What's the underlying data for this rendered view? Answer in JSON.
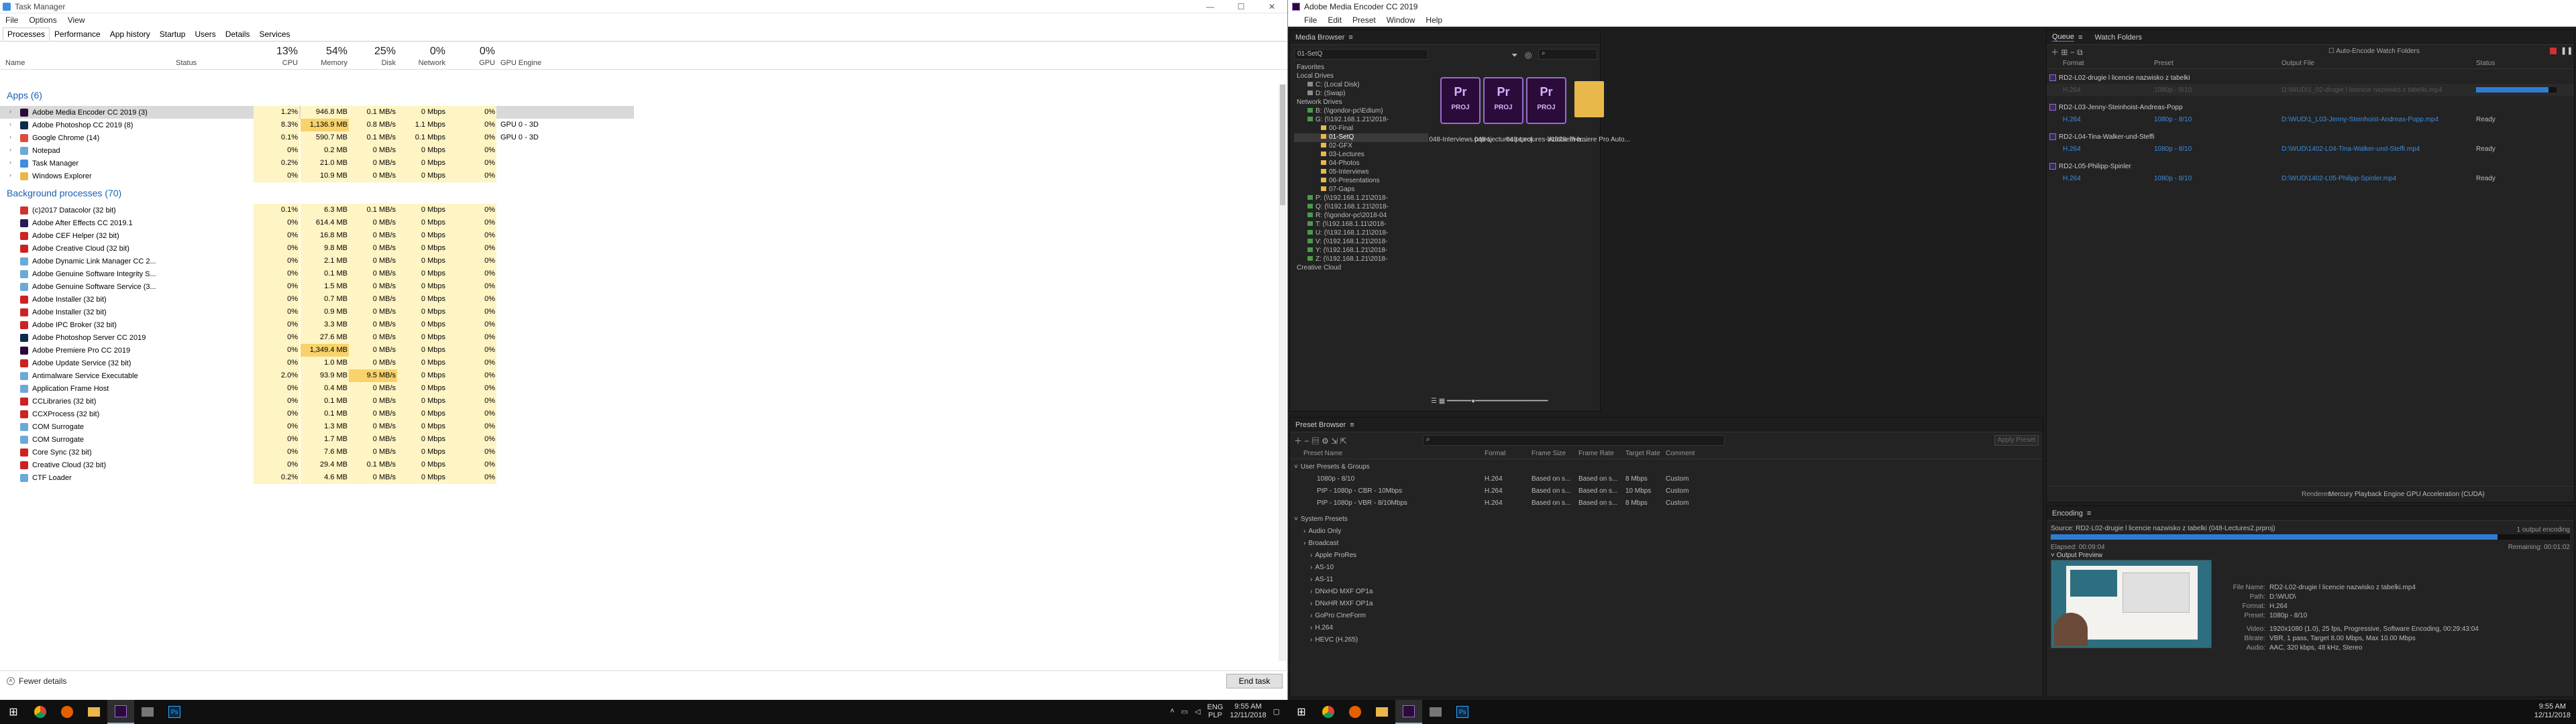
{
  "taskmanager": {
    "title": "Task Manager",
    "window_buttons": [
      "—",
      "☐",
      "✕"
    ],
    "menu": [
      "File",
      "Options",
      "View"
    ],
    "tabs": [
      "Processes",
      "Performance",
      "App history",
      "Startup",
      "Users",
      "Details",
      "Services"
    ],
    "header": {
      "name": "Name",
      "status": "Status",
      "cpu_pct": "13%",
      "cpu": "CPU",
      "mem_pct": "54%",
      "mem": "Memory",
      "disk_pct": "25%",
      "disk": "Disk",
      "net_pct": "0%",
      "net": "Network",
      "gpu_pct": "0%",
      "gpu": "GPU",
      "gpu_engine": "GPU Engine"
    },
    "apps_section": "Apps (6)",
    "apps": [
      {
        "name": "Adobe Media Encoder CC 2019 (3)",
        "cpu": "1.2%",
        "mem": "946.8 MB",
        "disk": "0.1 MB/s",
        "net": "0 Mbps",
        "gpu": "0%",
        "engine": "",
        "icon_color": "#2b0b3a"
      },
      {
        "name": "Adobe Photoshop CC 2019 (8)",
        "cpu": "8.3%",
        "mem": "1,136.9 MB",
        "disk": "0.8 MB/s",
        "net": "1.1 Mbps",
        "gpu": "0%",
        "engine": "GPU 0 - 3D",
        "icon_color": "#0a2c4a"
      },
      {
        "name": "Google Chrome (14)",
        "cpu": "0.1%",
        "mem": "590.7 MB",
        "disk": "0.1 MB/s",
        "net": "0.1 Mbps",
        "gpu": "0%",
        "engine": "GPU 0 - 3D",
        "icon_color": "#dd4b39"
      },
      {
        "name": "Notepad",
        "cpu": "0%",
        "mem": "0.2 MB",
        "disk": "0 MB/s",
        "net": "0 Mbps",
        "gpu": "0%",
        "engine": "",
        "icon_color": "#6aa9d8"
      },
      {
        "name": "Task Manager",
        "cpu": "0.2%",
        "mem": "21.0 MB",
        "disk": "0 MB/s",
        "net": "0 Mbps",
        "gpu": "0%",
        "engine": "",
        "icon_color": "#3b8ee0"
      },
      {
        "name": "Windows Explorer",
        "cpu": "0%",
        "mem": "10.9 MB",
        "disk": "0 MB/s",
        "net": "0 Mbps",
        "gpu": "0%",
        "engine": "",
        "icon_color": "#e8b84a"
      }
    ],
    "bg_section": "Background processes (70)",
    "background": [
      {
        "name": "(c)2017 Datacolor (32 bit)",
        "cpu": "0.1%",
        "mem": "6.3 MB",
        "disk": "0.1 MB/s",
        "net": "0 Mbps",
        "gpu": "0%",
        "icon_color": "#cc3333"
      },
      {
        "name": "Adobe After Effects CC 2019.1",
        "cpu": "0%",
        "mem": "614.4 MB",
        "disk": "0 MB/s",
        "net": "0 Mbps",
        "gpu": "0%",
        "icon_color": "#2a1a55"
      },
      {
        "name": "Adobe CEF Helper (32 bit)",
        "cpu": "0%",
        "mem": "16.8 MB",
        "disk": "0 MB/s",
        "net": "0 Mbps",
        "gpu": "0%",
        "icon_color": "#cc2222"
      },
      {
        "name": "Adobe Creative Cloud (32 bit)",
        "cpu": "0%",
        "mem": "9.8 MB",
        "disk": "0 MB/s",
        "net": "0 Mbps",
        "gpu": "0%",
        "icon_color": "#cc2222"
      },
      {
        "name": "Adobe Dynamic Link Manager CC 2...",
        "cpu": "0%",
        "mem": "2.1 MB",
        "disk": "0 MB/s",
        "net": "0 Mbps",
        "gpu": "0%",
        "icon_color": "#6aa9d8"
      },
      {
        "name": "Adobe Genuine Software Integrity S...",
        "cpu": "0%",
        "mem": "0.1 MB",
        "disk": "0 MB/s",
        "net": "0 Mbps",
        "gpu": "0%",
        "icon_color": "#6aa9d8"
      },
      {
        "name": "Adobe Genuine Software Service (3...",
        "cpu": "0%",
        "mem": "1.5 MB",
        "disk": "0 MB/s",
        "net": "0 Mbps",
        "gpu": "0%",
        "icon_color": "#6aa9d8"
      },
      {
        "name": "Adobe Installer (32 bit)",
        "cpu": "0%",
        "mem": "0.7 MB",
        "disk": "0 MB/s",
        "net": "0 Mbps",
        "gpu": "0%",
        "icon_color": "#cc2222"
      },
      {
        "name": "Adobe Installer (32 bit)",
        "cpu": "0%",
        "mem": "0.9 MB",
        "disk": "0 MB/s",
        "net": "0 Mbps",
        "gpu": "0%",
        "icon_color": "#cc2222"
      },
      {
        "name": "Adobe IPC Broker (32 bit)",
        "cpu": "0%",
        "mem": "3.3 MB",
        "disk": "0 MB/s",
        "net": "0 Mbps",
        "gpu": "0%",
        "icon_color": "#cc2222"
      },
      {
        "name": "Adobe Photoshop Server CC 2019",
        "cpu": "0%",
        "mem": "27.6 MB",
        "disk": "0 MB/s",
        "net": "0 Mbps",
        "gpu": "0%",
        "icon_color": "#0a2c4a"
      },
      {
        "name": "Adobe Premiere Pro CC 2019",
        "cpu": "0%",
        "mem": "1,349.4 MB",
        "disk": "0 MB/s",
        "net": "0 Mbps",
        "gpu": "0%",
        "icon_color": "#2b0b3a"
      },
      {
        "name": "Adobe Update Service (32 bit)",
        "cpu": "0%",
        "mem": "1.0 MB",
        "disk": "0 MB/s",
        "net": "0 Mbps",
        "gpu": "0%",
        "icon_color": "#cc2222"
      },
      {
        "name": "Antimalware Service Executable",
        "cpu": "2.0%",
        "mem": "93.9 MB",
        "disk": "9.5 MB/s",
        "net": "0 Mbps",
        "gpu": "0%",
        "icon_color": "#6aa9d8"
      },
      {
        "name": "Application Frame Host",
        "cpu": "0%",
        "mem": "0.4 MB",
        "disk": "0 MB/s",
        "net": "0 Mbps",
        "gpu": "0%",
        "icon_color": "#6aa9d8"
      },
      {
        "name": "CCLibraries (32 bit)",
        "cpu": "0%",
        "mem": "0.1 MB",
        "disk": "0 MB/s",
        "net": "0 Mbps",
        "gpu": "0%",
        "icon_color": "#cc2222"
      },
      {
        "name": "CCXProcess (32 bit)",
        "cpu": "0%",
        "mem": "0.1 MB",
        "disk": "0 MB/s",
        "net": "0 Mbps",
        "gpu": "0%",
        "icon_color": "#cc2222"
      },
      {
        "name": "COM Surrogate",
        "cpu": "0%",
        "mem": "1.3 MB",
        "disk": "0 MB/s",
        "net": "0 Mbps",
        "gpu": "0%",
        "icon_color": "#6aa9d8"
      },
      {
        "name": "COM Surrogate",
        "cpu": "0%",
        "mem": "1.7 MB",
        "disk": "0 MB/s",
        "net": "0 Mbps",
        "gpu": "0%",
        "icon_color": "#6aa9d8"
      },
      {
        "name": "Core Sync (32 bit)",
        "cpu": "0%",
        "mem": "7.6 MB",
        "disk": "0 MB/s",
        "net": "0 Mbps",
        "gpu": "0%",
        "icon_color": "#cc2222"
      },
      {
        "name": "Creative Cloud (32 bit)",
        "cpu": "0%",
        "mem": "29.4 MB",
        "disk": "0.1 MB/s",
        "net": "0 Mbps",
        "gpu": "0%",
        "icon_color": "#cc2222"
      },
      {
        "name": "CTF Loader",
        "cpu": "0.2%",
        "mem": "4.6 MB",
        "disk": "0 MB/s",
        "net": "0 Mbps",
        "gpu": "0%",
        "icon_color": "#6aa9d8"
      }
    ],
    "fewer_details": "Fewer details",
    "end_task": "End task"
  },
  "taskbar_left": {
    "lang": "ENG\nPLP",
    "time": "9:55 AM",
    "date": "12/11/2018"
  },
  "ame": {
    "title": "Adobe Media Encoder CC 2019",
    "menu": [
      "File",
      "Edit",
      "Preset",
      "Window",
      "Help"
    ],
    "media_browser": {
      "title": "Media Browser",
      "path": "01-SetQ",
      "favorites": "Favorites",
      "local_drives": "Local Drives",
      "drives": [
        "C: (Local Disk)",
        "D: (Swap)"
      ],
      "network_drives": "Network Drives",
      "net_drives": [
        "B: (\\\\gondor-pc\\Edium)",
        "G: (\\\\192.168.1.21\\2018-"
      ],
      "folders": [
        "00-Final",
        "01-SetQ",
        "02-GFX",
        "03-Lectures",
        "04-Photos",
        "05-Interviews",
        "06-Presentations",
        "07-Gaps"
      ],
      "more_drives": [
        "P: (\\\\192.168.1.21\\2018-",
        "Q: (\\\\192.168.1.21\\2018-",
        "R: (\\\\gondor-pc\\2018-04",
        "T: (\\\\192.168.1.11\\2018-",
        "U: (\\\\192.168.1.21\\2018-",
        "V: (\\\\192.168.1.21\\2018-",
        "Y: (\\\\192.168.1.21\\2018-",
        "Z: (\\\\192.168.1.21\\2018-"
      ],
      "creative_cloud": "Creative Cloud",
      "files": [
        "048-Interviews.prproj",
        "048-Lectures.prproj",
        "048-Lectures-b1028ebi-b...",
        "Adobe Premiere Pro Auto..."
      ]
    },
    "preset_browser": {
      "title": "Preset Browser",
      "apply_preset": "Apply Preset",
      "cols": [
        "Preset Name",
        "Format",
        "Frame Size",
        "Frame Rate",
        "Target Rate",
        "Comment"
      ],
      "user_presets": "User Presets & Groups",
      "user_rows": [
        {
          "name": "1080p - 8/10",
          "format": "H.264",
          "fsize": "Based on s...",
          "frate": "Based on s...",
          "trate": "8 Mbps",
          "comment": "Custom"
        },
        {
          "name": "PIP - 1080p - CBR - 10Mbps",
          "format": "H.264",
          "fsize": "Based on s...",
          "frate": "Based on s...",
          "trate": "10 Mbps",
          "comment": "Custom"
        },
        {
          "name": "PIP - 1080p - VBR - 8/10Mbps",
          "format": "H.264",
          "fsize": "Based on s...",
          "frate": "Based on s...",
          "trate": "8 Mbps",
          "comment": "Custom"
        }
      ],
      "system_presets": "System Presets",
      "sys_items": [
        "Audio Only",
        "Broadcast",
        "Apple ProRes",
        "AS-10",
        "AS-11",
        "DNxHD MXF OP1a",
        "DNxHR MXF OP1a",
        "GoPro CineForm",
        "H.264",
        "HEVC (H.265)"
      ]
    },
    "queue": {
      "tab_queue": "Queue",
      "tab_watch": "Watch Folders",
      "auto_encode": "Auto-Encode Watch Folders",
      "cols": [
        "Format",
        "Preset",
        "Output File",
        "Status"
      ],
      "items": [
        {
          "source": "RD2-L02-drugie l licencie nazwisko z tabelki",
          "format": "H.264",
          "preset": "1080p - 8/10",
          "output": "D:\\WUD\\1_02-drugie l licencie nazwisko z tabelki.mp4",
          "status": "",
          "progress": 0.9
        },
        {
          "source": "RD2-L03-Jenny-Steinhoist-Andreas-Popp",
          "format": "H.264",
          "preset": "1080p - 8/10",
          "output": "D:\\WUD\\1_L03-Jenny-Steinhoist-Andreas-Popp.mp4",
          "status": "Ready"
        },
        {
          "source": "RD2-L04-Tina-Walker-und-Steffi",
          "format": "H.264",
          "preset": "1080p - 8/10",
          "output": "D:\\WUD\\1402-L04-Tina-Walker-und-Steffi.mp4",
          "status": "Ready"
        },
        {
          "source": "RD2-L05-Philipp-Spinler",
          "format": "H.264",
          "preset": "1080p - 8/10",
          "output": "D:\\WUD\\1402-L05-Philipp-Spinler.mp4",
          "status": "Ready"
        }
      ],
      "renderer_label": "Renderer:",
      "renderer": "Mercury Playback Engine GPU Acceleration (CUDA)"
    },
    "encoding": {
      "title": "Encoding",
      "source": "Source: RD2-L02-drugie l licencie nazwisko z tabelki (048-Lectures2.prproj)",
      "outputs": "1 output encoding",
      "elapsed": "Elapsed: 00:09:04",
      "remaining": "Remaining: 00:01:02",
      "progress": 0.86,
      "output_preview": "Output Preview",
      "meta": [
        {
          "k": "File Name:",
          "v": "RD2-L02-drugie l licencie nazwisko z tabelki.mp4"
        },
        {
          "k": "Path:",
          "v": "D:\\WUD\\"
        },
        {
          "k": "Format:",
          "v": "H.264"
        },
        {
          "k": "Preset:",
          "v": "1080p - 8/10"
        },
        {
          "k": "Video:",
          "v": "1920x1080 (1.0), 25 fps, Progressive, Software Encoding, 00:29:43:04"
        },
        {
          "k": "Bitrate:",
          "v": "VBR, 1 pass, Target 8.00 Mbps, Max 10.00 Mbps"
        },
        {
          "k": "Audio:",
          "v": "AAC, 320 kbps, 48 kHz, Stereo"
        }
      ]
    }
  },
  "taskbar_right": {
    "time": "9:55 AM",
    "date": "12/11/2018"
  }
}
